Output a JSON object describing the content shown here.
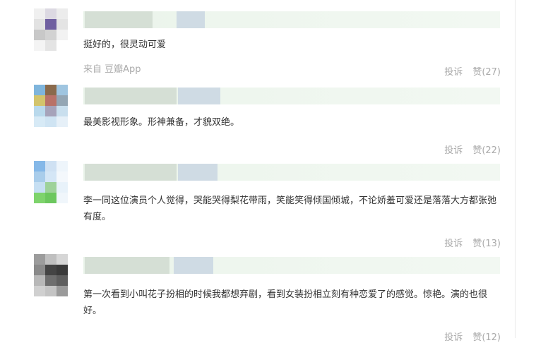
{
  "comments": [
    {
      "text": "挺好的，很灵动可爱",
      "source": "来自 豆瓣App",
      "report_label": "投诉",
      "like_label": "赞(27)",
      "avatar_colors": [
        "#f0f0f0",
        "#dcd9e2",
        "#ececec",
        "#e2e2e2",
        "#6f5fa0",
        "#e4e4e4",
        "#c8c8c8",
        "#d2d2d2",
        "#f2f2f2",
        "#f4f4f4",
        "#e4e4e4",
        "#ffffff"
      ]
    },
    {
      "text": "最美影视形象。形神兼备，才貌双绝。",
      "report_label": "投诉",
      "like_label": "赞(22)",
      "avatar_colors": [
        "#7fb5dc",
        "#8a6a4c",
        "#9fc5e0",
        "#d3c46c",
        "#b97268",
        "#94a6b4",
        "#b9d9ec",
        "#a6a3ba",
        "#c9dfee",
        "#d7eaf6",
        "#cfe4f3",
        "#e6f0f8"
      ]
    },
    {
      "text": "李一同这位演员个人觉得，哭能哭得梨花带雨，笑能笑得倾国倾城，不论娇羞可爱还是落落大方都张弛有度。",
      "report_label": "投诉",
      "like_label": "赞(13)",
      "avatar_colors": [
        "#85b8e8",
        "#cfe1f3",
        "#eef5fb",
        "#a9cdeb",
        "#d4e6f6",
        "#f4f8fc",
        "#c6dff3",
        "#9ed29a",
        "#e8f2fa",
        "#7ed36c",
        "#6cc75e",
        "#f0f6fb"
      ]
    },
    {
      "text": "第一次看到小叫花子扮相的时候我都想弃剧，看到女装扮相立刻有种恋爱了的感觉。惊艳。演的也很好。",
      "report_label": "投诉",
      "like_label": "赞(12)",
      "avatar_colors": [
        "#9c9c9c",
        "#bfbfbf",
        "#d6d6d6",
        "#8a8a8a",
        "#444444",
        "#3a3a3a",
        "#b8b8b8",
        "#6e6e6e",
        "#5e5e5e",
        "#d0d0d0",
        "#c4c4c4",
        "#9a9a9a"
      ]
    }
  ]
}
